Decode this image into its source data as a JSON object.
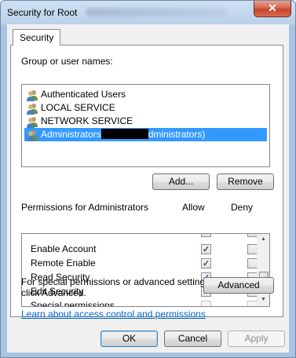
{
  "window": {
    "title": "Security for Root",
    "close_glyph": "✕"
  },
  "tab": {
    "label": "Security"
  },
  "groups": {
    "label": "Group or user names:",
    "items": [
      {
        "name": "Authenticated Users"
      },
      {
        "name": "LOCAL SERVICE"
      },
      {
        "name": "NETWORK SERVICE"
      },
      {
        "name_before": "Administrators",
        "name_after": "dministrators)"
      }
    ],
    "selected_index": 3
  },
  "buttons": {
    "add": "Add...",
    "remove": "Remove",
    "advanced": "Advanced",
    "ok": "OK",
    "cancel": "Cancel",
    "apply": "Apply"
  },
  "permissions": {
    "label": "Permissions for Administrators",
    "allow_header": "Allow",
    "deny_header": "Deny",
    "rows": [
      {
        "name": "Enable Account",
        "allow": true,
        "deny": false
      },
      {
        "name": "Remote Enable",
        "allow": true,
        "deny": false
      },
      {
        "name": "Read Security",
        "allow": true,
        "deny": false
      },
      {
        "name": "Edit Security",
        "allow": true,
        "deny": false
      },
      {
        "name": "Special permissions",
        "allow": false,
        "deny": false,
        "disabled": true
      }
    ]
  },
  "advanced_hint": {
    "line1": "For special permissions or advanced settings,",
    "line2": "click Advanced."
  },
  "help_link": "Learn about access control and permissions",
  "colors": {
    "selection": "#3399ff",
    "link": "#0066cc",
    "close": "#c7432b"
  }
}
